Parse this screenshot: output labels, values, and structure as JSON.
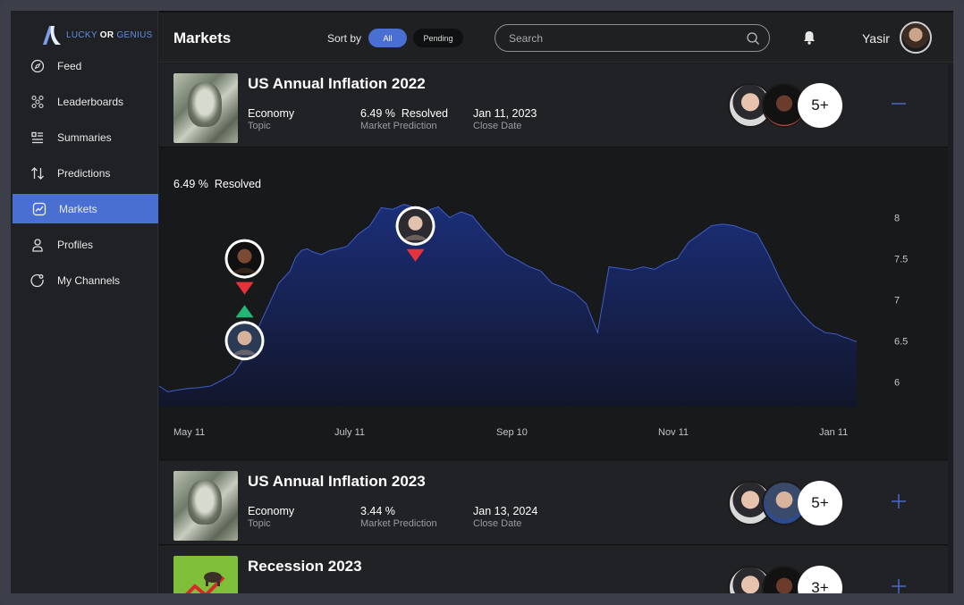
{
  "app": {
    "logo": {
      "word1": "LUCKY",
      "word2": "OR",
      "word3": "GENIUS"
    },
    "brand_color": "#4a6fd3"
  },
  "sidebar": {
    "items": [
      {
        "label": "Feed",
        "icon": "compass-icon",
        "active": false
      },
      {
        "label": "Leaderboards",
        "icon": "network-icon",
        "active": false
      },
      {
        "label": "Summaries",
        "icon": "list-icon",
        "active": false
      },
      {
        "label": "Predictions",
        "icon": "sort-arrows-icon",
        "active": false
      },
      {
        "label": "Markets",
        "icon": "trend-chart-icon",
        "active": true
      },
      {
        "label": "Profiles",
        "icon": "user-icon",
        "active": false
      },
      {
        "label": "My Channels",
        "icon": "channel-icon",
        "active": false
      }
    ]
  },
  "header": {
    "title": "Markets",
    "sort_label": "Sort by",
    "sort_all": "All",
    "sort_pending": "Pending",
    "search_placeholder": "Search",
    "user_name": "Yasir"
  },
  "markets": [
    {
      "title": "US Annual Inflation 2022",
      "topic": "Economy",
      "topic_label": "Topic",
      "prediction": "6.49 %  Resolved",
      "prediction_label": "Market Prediction",
      "close_date": "Jan 11, 2023",
      "close_label": "Close Date",
      "more": "5+",
      "expanded": true
    },
    {
      "title": "US Annual Inflation 2023",
      "topic": "Economy",
      "topic_label": "Topic",
      "prediction": "3.44 %",
      "prediction_label": "Market Prediction",
      "close_date": "Jan 13, 2024",
      "close_label": "Close Date",
      "more": "5+",
      "expanded": false
    },
    {
      "title": "Recession 2023",
      "more": "3+",
      "expanded": false
    }
  ],
  "chart_data": {
    "type": "area",
    "status_text": "6.49 %  Resolved",
    "x_tick_labels": [
      "May 11",
      "July 11",
      "Sep 10",
      "Nov 11",
      "Jan 11"
    ],
    "y_ticks": [
      6,
      6.5,
      7,
      7.5,
      8
    ],
    "ylim": [
      5.7,
      8.2
    ],
    "x_range": [
      0,
      245
    ],
    "series": [
      {
        "x": [
          0,
          3,
          6,
          10,
          14,
          18,
          22,
          26,
          30,
          34,
          38,
          42,
          46,
          48,
          50,
          52,
          54,
          57,
          60,
          63,
          66,
          70,
          74,
          78,
          82,
          86,
          90,
          94,
          98,
          102,
          106,
          110,
          114,
          118,
          122,
          126,
          130,
          134,
          138,
          142,
          146,
          150,
          154,
          158,
          162,
          166,
          170,
          174,
          178,
          182,
          186,
          190,
          194,
          198,
          202,
          206,
          210,
          214,
          218,
          222,
          226,
          230,
          234,
          238,
          240,
          242,
          244,
          245
        ],
        "y": [
          5.95,
          5.88,
          5.9,
          5.92,
          5.93,
          5.95,
          6.02,
          6.1,
          6.3,
          6.6,
          6.9,
          7.2,
          7.35,
          7.52,
          7.6,
          7.62,
          7.58,
          7.55,
          7.6,
          7.62,
          7.65,
          7.8,
          7.9,
          8.12,
          8.1,
          8.16,
          8.12,
          8.08,
          8.13,
          8.0,
          8.07,
          8.02,
          7.85,
          7.7,
          7.55,
          7.48,
          7.4,
          7.35,
          7.2,
          7.15,
          7.08,
          6.95,
          6.6,
          7.4,
          7.38,
          7.36,
          7.4,
          7.37,
          7.45,
          7.5,
          7.7,
          7.8,
          7.9,
          7.92,
          7.9,
          7.85,
          7.8,
          7.55,
          7.25,
          7.0,
          6.82,
          6.68,
          6.6,
          6.58,
          6.55,
          6.53,
          6.5,
          6.49
        ]
      }
    ],
    "markers": [
      {
        "x": 30,
        "y": 7.15,
        "direction": "down",
        "color": "#e5323b",
        "who": "avatar-bearded"
      },
      {
        "x": 30,
        "y": 6.85,
        "direction": "up",
        "color": "#22b573",
        "who": "avatar-suit"
      },
      {
        "x": 90,
        "y": 7.55,
        "direction": "down",
        "color": "#e5323b",
        "who": "avatar-elon"
      }
    ],
    "area_color": "#1c2c6e",
    "line_color": "#3f5ec7",
    "grid": false
  }
}
